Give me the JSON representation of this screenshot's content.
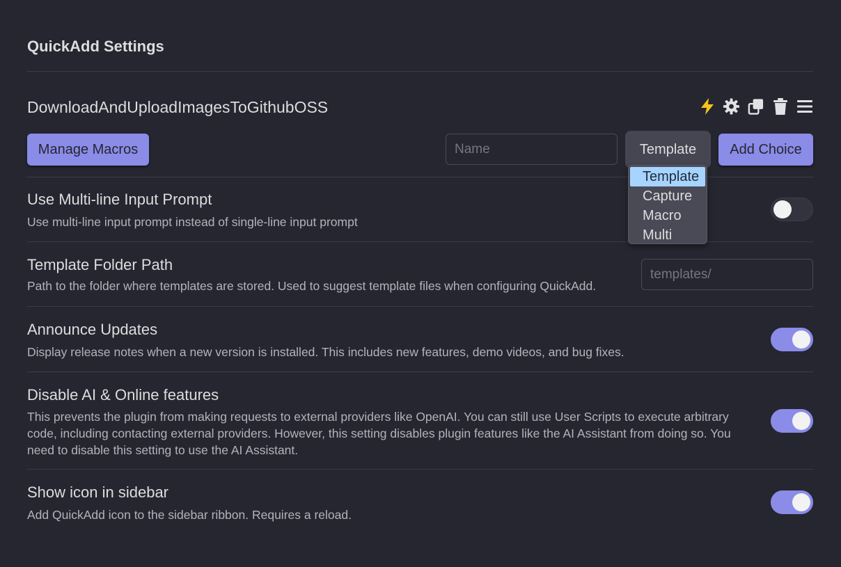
{
  "header": {
    "title": "QuickAdd Settings"
  },
  "choice": {
    "name": "DownloadAndUploadImagesToGithubOSS",
    "icons": [
      "lightning-icon",
      "gear-icon",
      "duplicate-icon",
      "trash-icon",
      "menu-icon"
    ]
  },
  "toolbar": {
    "manage_macros_label": "Manage Macros",
    "name_placeholder": "Name",
    "type_selected": "Template",
    "type_options": [
      "Template",
      "Capture",
      "Macro",
      "Multi"
    ],
    "add_choice_label": "Add Choice"
  },
  "settings": [
    {
      "name": "Use Multi-line Input Prompt",
      "desc": "Use multi-line input prompt instead of single-line input prompt",
      "enabled": false
    },
    {
      "name": "Template Folder Path",
      "desc": "Path to the folder where templates are stored. Used to suggest template files when configuring QuickAdd.",
      "placeholder": "templates/"
    },
    {
      "name": "Announce Updates",
      "desc": "Display release notes when a new version is installed. This includes new features, demo videos, and bug fixes.",
      "enabled": true
    },
    {
      "name": "Disable AI & Online features",
      "desc": "This prevents the plugin from making requests to external providers like OpenAI. You can still use User Scripts to execute arbitrary code, including contacting external providers. However, this setting disables plugin features like the AI Assistant from doing so. You need to disable this setting to use the AI Assistant.",
      "enabled": true
    },
    {
      "name": "Show icon in sidebar",
      "desc": "Add QuickAdd icon to the sidebar ribbon. Requires a reload.",
      "enabled": true
    }
  ],
  "colors": {
    "background": "#262630",
    "accent": "#8a8ce8",
    "lightning": "#f5c518"
  }
}
